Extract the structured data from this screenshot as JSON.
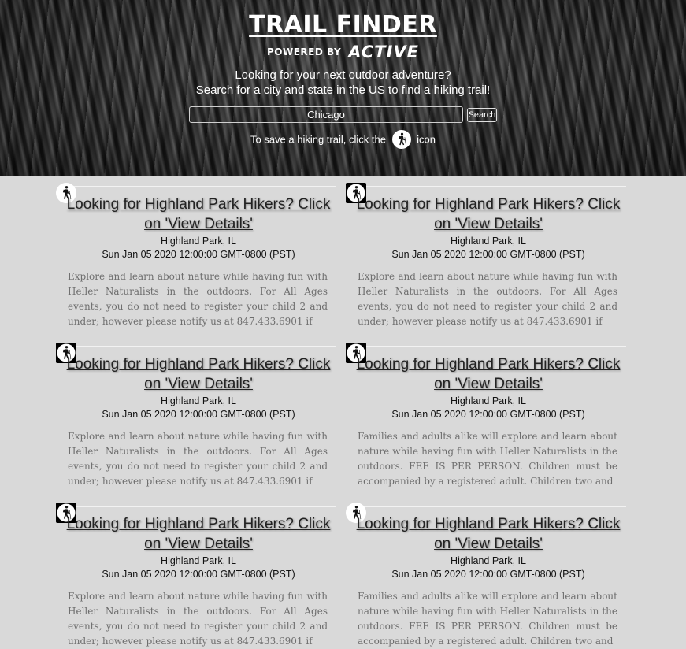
{
  "header": {
    "title": "TRAIL FINDER",
    "powered_by": "POWERED BY",
    "brand": "ACTIVE",
    "intro_line1": "Looking for your next outdoor adventure?",
    "intro_line2": "Search for a city and state in the US to find a hiking trail!",
    "search": {
      "value": "Chicago",
      "button_label": "Search"
    },
    "hint_before": "To save a hiking trail, click the",
    "hint_after": "icon",
    "hint_icon": "hiker-icon"
  },
  "results": [
    {
      "title": "Looking for Highland Park Hikers? Click on 'View Details'",
      "location": "Highland Park, IL",
      "date": "Sun Jan 05 2020 12:00:00 GMT-0800 (PST)",
      "description": "Explore and learn about nature while having fun with Heller Naturalists in the outdoors. For All Ages events, you do not need to register your child 2 and under; however please notify us at 847.433.6901 if",
      "save_icon": "hiker-icon"
    },
    {
      "title": "Looking for Highland Park Hikers? Click on 'View Details'",
      "location": "Highland Park, IL",
      "date": "Sun Jan 05 2020 12:00:00 GMT-0800 (PST)",
      "description": "Explore and learn about nature while having fun with Heller Naturalists in the outdoors. For All Ages events, you do not need to register your child 2 and under; however please notify us at 847.433.6901 if",
      "save_icon": "hiker-icon"
    },
    {
      "title": "Looking for Highland Park Hikers? Click on 'View Details'",
      "location": "Highland Park, IL",
      "date": "Sun Jan 05 2020 12:00:00 GMT-0800 (PST)",
      "description": "Explore and learn about nature while having fun with Heller Naturalists in the outdoors. For All Ages events, you do not need to register your child 2 and under; however please notify us at 847.433.6901 if",
      "save_icon": "hiker-icon"
    },
    {
      "title": "Looking for Highland Park Hikers? Click on 'View Details'",
      "location": "Highland Park, IL",
      "date": "Sun Jan 05 2020 12:00:00 GMT-0800 (PST)",
      "description": "Families and adults alike will explore and learn about nature while having fun with Heller Naturalists in the outdoors. FEE IS PER PERSON. Children must be accompanied by a registered adult. Children two and",
      "save_icon": "hiker-icon"
    },
    {
      "title": "Looking for Highland Park Hikers? Click on 'View Details'",
      "location": "Highland Park, IL",
      "date": "Sun Jan 05 2020 12:00:00 GMT-0800 (PST)",
      "description": "Explore and learn about nature while having fun with Heller Naturalists in the outdoors. For All Ages events, you do not need to register your child 2 and under; however please notify us at 847.433.6901 if",
      "save_icon": "hiker-icon"
    },
    {
      "title": "Looking for Highland Park Hikers? Click on 'View Details'",
      "location": "Highland Park, IL",
      "date": "Sun Jan 05 2020 12:00:00 GMT-0800 (PST)",
      "description": "Families and adults alike will explore and learn about nature while having fun with Heller Naturalists in the outdoors. FEE IS PER PERSON. Children must be accompanied by a registered adult. Children two and",
      "save_icon": "hiker-icon"
    }
  ]
}
